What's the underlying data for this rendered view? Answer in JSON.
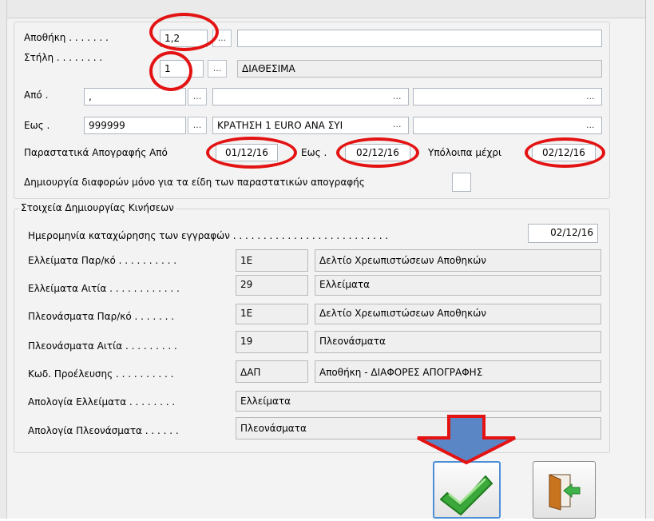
{
  "filters": {
    "warehouse_label": "Αποθήκη . . . . . . .",
    "warehouse_value": "1,2",
    "warehouse_btn": "...",
    "warehouse_desc": "",
    "column_label": "Στήλη . . . . . . . .",
    "column_value": "1",
    "column_btn": "...",
    "column_desc": "ΔΙΑΘΕΣΙΜΑ",
    "from_label": "Από .",
    "from_value": ",",
    "from_btn": "...",
    "from_desc_btn": "...",
    "from_extra_btn": "...",
    "to_label": "Εως .",
    "to_value": "999999",
    "to_btn": "...",
    "to_desc": "ΚΡΑΤΗΣΗ 1 EURO ΑΝΑ ΣΥΙ",
    "to_desc_btn": "...",
    "to_extra_btn": "...",
    "docs_from_label": "Παραστατικά Απογραφής Από",
    "docs_from_value": "01/12/16",
    "docs_to_label": "Εως .",
    "docs_to_value": "02/12/16",
    "balances_label": "Υπόλοιπα μέχρι",
    "balances_value": "02/12/16",
    "diff_only_label": "Δημιουργία διαφορών μόνο για τα είδη των παραστατικών απογραφής"
  },
  "movements": {
    "title": "Στοιχεία Δημιουργίας Κινήσεων",
    "date_label": "Ημερομηνία καταχώρησης των εγγραφών . . . . . . . . . . . . . . . . . . . . . . . . . .",
    "date_value": "02/12/16",
    "rows": [
      {
        "label": "Ελλείματα Παρ/κό . . . . . . . . . .",
        "code": "1Ε",
        "desc": "Δελτίο Χρεωπιστώσεων Αποθηκών"
      },
      {
        "label": "Ελλείματα Αιτία . . . . . . . . . . . .",
        "code": "29",
        "desc": "Ελλείματα"
      },
      {
        "label": "Πλεονάσματα Παρ/κό . . . . . . .",
        "code": "1Ε",
        "desc": "Δελτίο Χρεωπιστώσεων Αποθηκών"
      },
      {
        "label": "Πλεονάσματα Αιτία . . . . . . . . .",
        "code": "19",
        "desc": "Πλεονάσματα"
      },
      {
        "label": "Κωδ. Προέλευσης . . . . . . . . . .",
        "code": "ΔΑΠ",
        "desc": "Αποθήκη - ΔΙΑΦΟΡΕΣ ΑΠΟΓΡΑΦΗΣ"
      }
    ],
    "shortage_expl_label": "Απολογία Ελλείματα . . . . . . . .",
    "shortage_expl_value": "Ελλείματα",
    "surplus_expl_label": "Απολογία Πλεονάσματα . . . . . .",
    "surplus_expl_value": "Πλεονάσματα"
  },
  "icons": {
    "ok": "green-checkmark-icon",
    "exit": "exit-door-icon",
    "pointer": "down-arrow-icon"
  },
  "colors": {
    "highlight": "#e41313",
    "arrow": "#5a86c5",
    "check": "#3aa83a"
  }
}
